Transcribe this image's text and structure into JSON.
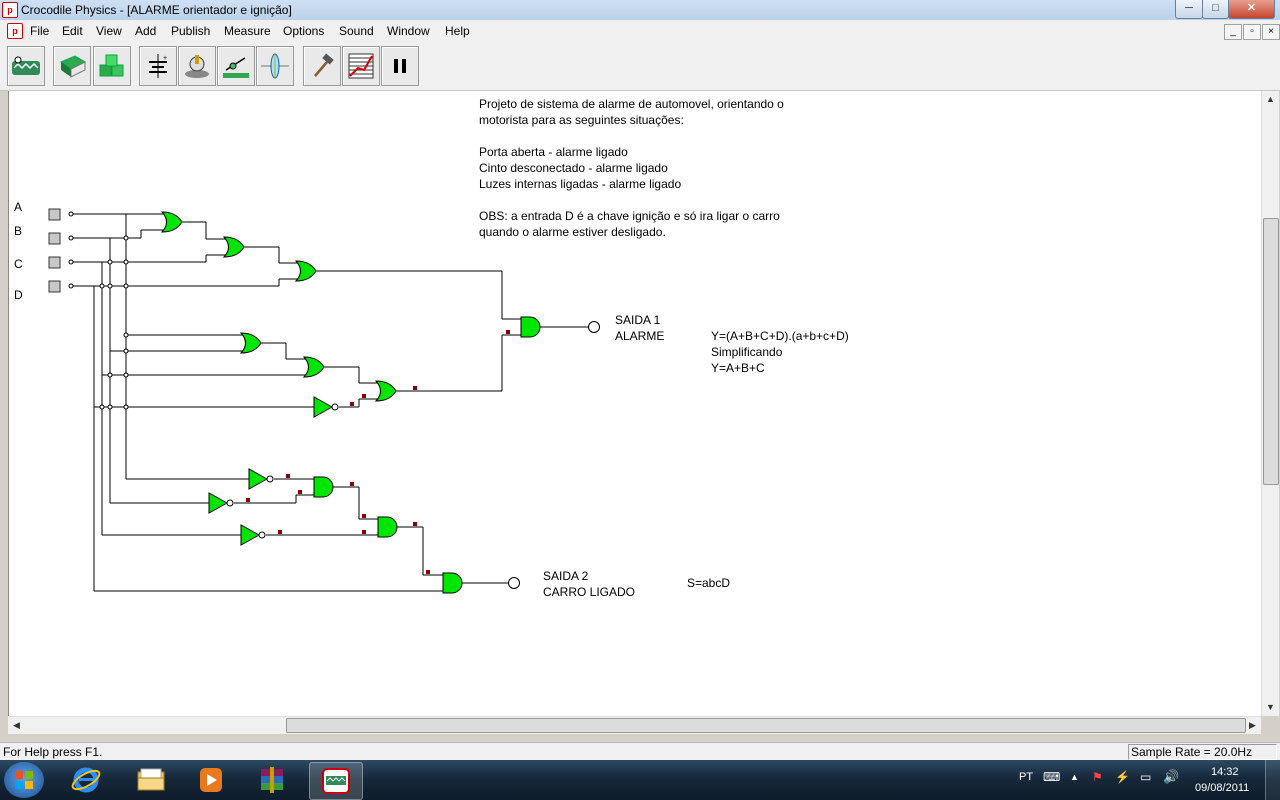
{
  "window": {
    "title": "Crocodile Physics - [ALARME orientador e ignição]",
    "minimize": "─",
    "maximize": "□",
    "close": "✕"
  },
  "menu": {
    "items": [
      "File",
      "Edit",
      "View",
      "Add",
      "Publish",
      "Measure",
      "Options",
      "Sound",
      "Window",
      "Help"
    ]
  },
  "toolbar": {
    "buttons": [
      "crocodile-logo-icon",
      "book-icon",
      "parts-library-icon",
      "electronics-components-icon",
      "mechanics-components-icon",
      "motion-components-icon",
      "optics-components-icon",
      "hammer-icon",
      "graph-icon",
      "pause-icon"
    ]
  },
  "canvas": {
    "description_lines": [
      "Projeto de sistema de alarme de automovel, orientando o",
      "motorista para as seguintes situações:",
      "",
      "Porta aberta - alarme ligado",
      "Cinto desconectado - alarme ligado",
      "Luzes internas ligadas - alarme ligado",
      "",
      "OBS: a entrada D é a chave ignição e só ira ligar o carro",
      "quando o alarme estiver desligado."
    ],
    "inputs": [
      "A",
      "B",
      "C",
      "D"
    ],
    "output1": {
      "line1": "SAIDA 1",
      "line2": "ALARME"
    },
    "formula1": {
      "line1": "Y=(A+B+C+D).(a+b+c+D)",
      "line2": "Simplificando",
      "line3": "Y=A+B+C"
    },
    "output2": {
      "line1": "SAIDA 2",
      "line2": "CARRO LIGADO"
    },
    "formula2": "S=abcD",
    "colors": {
      "gate_fill": "#00e600",
      "wire": "#000000",
      "marker": "#8b0000"
    }
  },
  "status": {
    "help": "For Help press F1.",
    "sample_rate": "Sample Rate =  20.0Hz"
  },
  "taskbar": {
    "apps": [
      "windows-start-icon",
      "internet-explorer-icon",
      "file-explorer-icon",
      "media-player-icon",
      "winrar-icon",
      "crocodile-physics-icon"
    ],
    "language": "PT",
    "time": "14:32",
    "date": "09/08/2011"
  }
}
